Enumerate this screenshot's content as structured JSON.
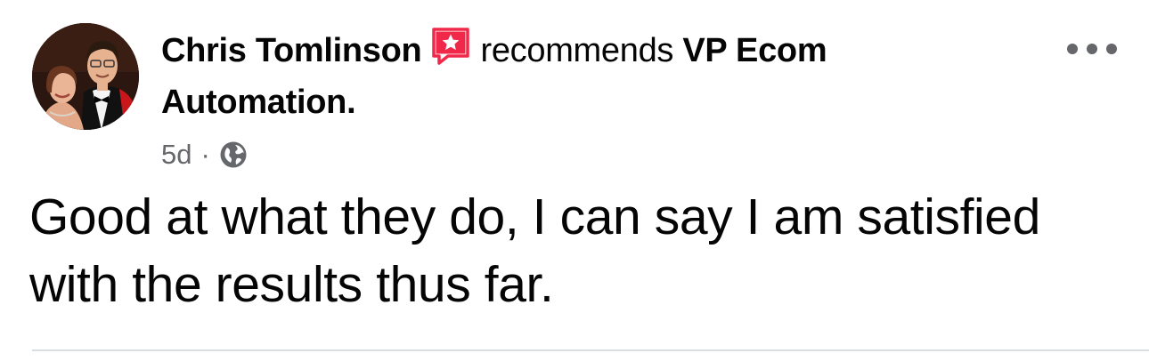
{
  "post": {
    "author": "Chris Tomlinson",
    "recommend_icon": "recommendation-star-icon",
    "action": "recommends",
    "page_name": "VP Ecom Automation.",
    "time": "5d",
    "separator": "·",
    "audience_icon": "globe-icon",
    "more_icon": "more-options-icon",
    "body": "Good at what they do, I can say I am satisfied with the results thus far."
  },
  "colors": {
    "recommend_badge": "#f02849",
    "meta_text": "#65676b",
    "divider": "#dadde1"
  }
}
